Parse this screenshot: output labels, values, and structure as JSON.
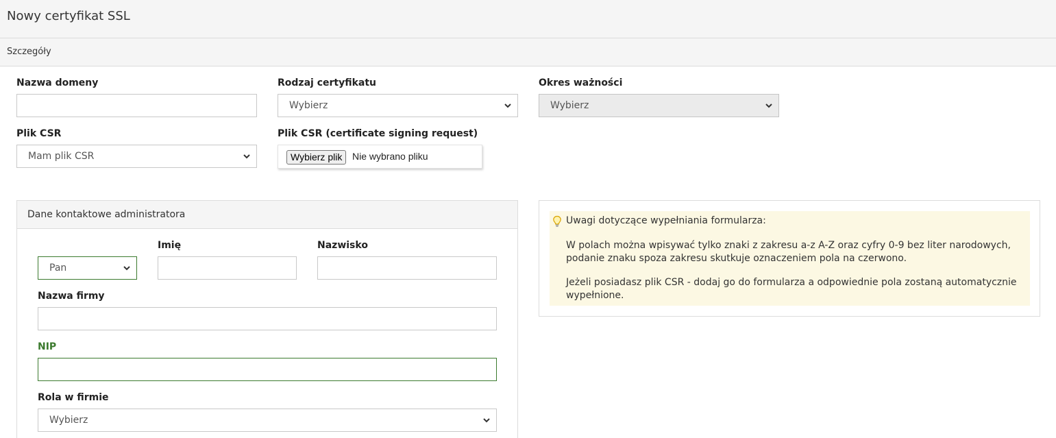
{
  "header": {
    "title": "Nowy certyfikat SSL"
  },
  "section": {
    "title": "Szczegóły"
  },
  "form": {
    "domain_name": {
      "label": "Nazwa domeny",
      "value": ""
    },
    "cert_type": {
      "label": "Rodzaj certyfikatu",
      "selected": "Wybierz"
    },
    "validity": {
      "label": "Okres ważności",
      "selected": "Wybierz"
    },
    "csr_file": {
      "label": "Plik CSR",
      "selected": "Mam plik CSR"
    },
    "csr_upload": {
      "label": "Plik CSR (certificate signing request)",
      "button": "Wybierz plik",
      "status": "Nie wybrano pliku"
    }
  },
  "admin_contact": {
    "title": "Dane kontaktowe administratora",
    "salutation": {
      "selected": "Pan"
    },
    "first_name": {
      "label": "Imię",
      "value": ""
    },
    "last_name": {
      "label": "Nazwisko",
      "value": ""
    },
    "company": {
      "label": "Nazwa firmy",
      "value": ""
    },
    "nip": {
      "label": "NIP",
      "value": ""
    },
    "role": {
      "label": "Rola w firmie",
      "selected": "Wybierz"
    }
  },
  "notes": {
    "title": "Uwagi dotyczące wypełniania formularza:",
    "paragraphs": [
      "W polach można wpisywać tylko znaki z zakresu a-z A-Z oraz cyfry 0-9 bez liter narodowych, podanie znaku spoza zakresu skutkuje oznaczeniem pola na czerwono.",
      "Jeżeli posiadasz plik CSR - dodaj go do formularza a odpowiednie pola zostaną automatycznie wypełnione."
    ]
  },
  "colors": {
    "valid": "#3b7a2e",
    "note_bg": "#fcf8e3",
    "header_bg": "#f5f5f5"
  },
  "icons": {
    "select_arrow": "chevron-down-icon",
    "tip": "lightbulb-icon"
  }
}
